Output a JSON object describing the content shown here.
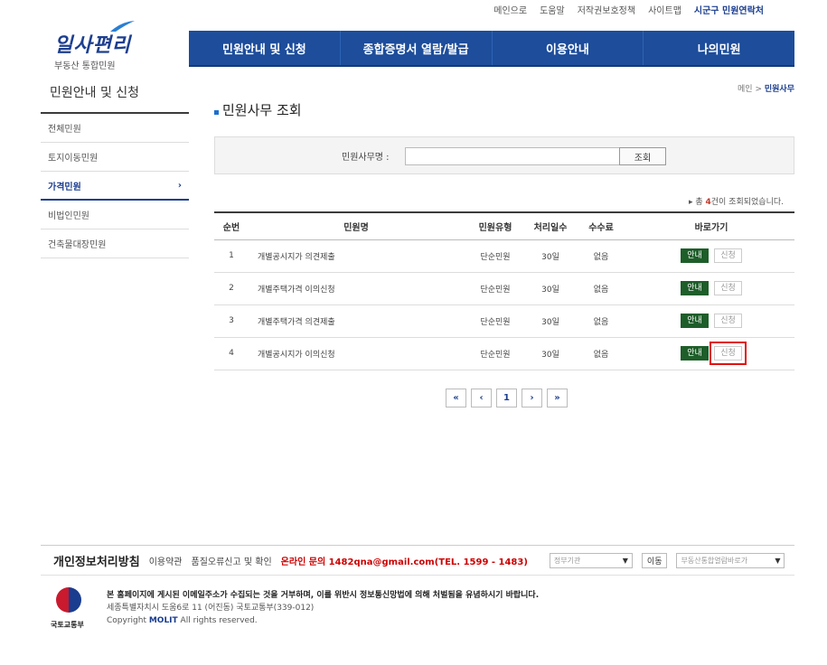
{
  "util_links": [
    "메인으로",
    "도움말",
    "저작권보호정책",
    "사이트맵",
    "시군구 민원연락처"
  ],
  "logo": {
    "word": "일사편리",
    "sub": "부동산 통합민원"
  },
  "nav": [
    "민원안내 및 신청",
    "종합증명서 열람/발급",
    "이용안내",
    "나의민원"
  ],
  "sidebar": {
    "title": "민원안내 및 신청",
    "items": [
      "전체민원",
      "토지이동민원",
      "가격민원",
      "비법인민원",
      "건축물대장민원"
    ],
    "active_index": 2,
    "arrow": "›"
  },
  "breadcrumb": {
    "home": "메인",
    "sep": ">",
    "current": "민원사무"
  },
  "page_title": "민원사무 조회",
  "search": {
    "label": "민원사무명 :",
    "value": "",
    "button": "조회"
  },
  "count": {
    "prefix": "▸ 총 ",
    "num": "4",
    "suffix": "건이 조회되었습니다."
  },
  "table": {
    "headers": [
      "순번",
      "민원명",
      "민원유형",
      "처리일수",
      "수수료",
      "바로가기"
    ],
    "rows": [
      {
        "no": "1",
        "name": "개별공시지가 의견제출",
        "type": "단순민원",
        "days": "30일",
        "fee": "없음",
        "guide": "안내",
        "apply": "신청"
      },
      {
        "no": "2",
        "name": "개별주택가격 이의신청",
        "type": "단순민원",
        "days": "30일",
        "fee": "없음",
        "guide": "안내",
        "apply": "신청"
      },
      {
        "no": "3",
        "name": "개별주택가격 의견제출",
        "type": "단순민원",
        "days": "30일",
        "fee": "없음",
        "guide": "안내",
        "apply": "신청"
      },
      {
        "no": "4",
        "name": "개별공시지가 이의신청",
        "type": "단순민원",
        "days": "30일",
        "fee": "없음",
        "guide": "안내",
        "apply": "신청"
      }
    ]
  },
  "paging": {
    "first": "«",
    "prev": "‹",
    "page": "1",
    "next": "›",
    "last": "»"
  },
  "footer": {
    "privacy": "개인정보처리방침",
    "terms": "이용약관",
    "report": "품질오류신고 및 확인",
    "contact": "온라인 문의 1482qna@gmail.com(TEL. 1599 - 1483)",
    "select1": "정부기관",
    "move": "이동",
    "select2": "부동산통합열람바로가",
    "org": "국토교통부",
    "line1": "본 홈페이지에 게시된 이메일주소가 수집되는 것을 거부하며, 이를 위반시 정보통신망법에 의해 처벌됨을 유념하시기 바랍니다.",
    "line2": "세종특별자치시 도움6로 11 (어진동) 국토교통부(339-012)",
    "copy_pre": "Copyright ",
    "copy_org": "MOLIT",
    "copy_post": " All rights reserved."
  },
  "colors": {
    "nav": "#1d4d9b",
    "guide_button": "#1e5e2a",
    "highlight": "#e31010"
  }
}
